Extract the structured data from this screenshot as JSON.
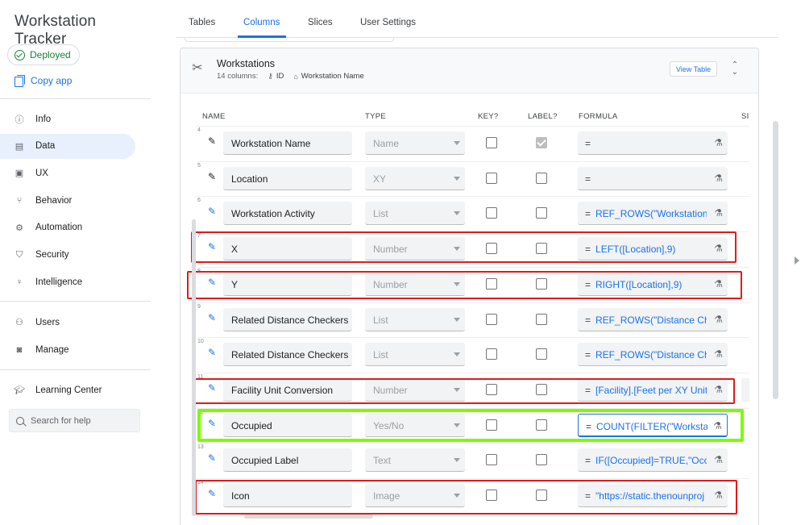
{
  "sidebar": {
    "app_title": "Workstation Tracker",
    "status_label": "Deployed",
    "copy_app_label": "Copy app",
    "nav_group_1": [
      {
        "label": "Info",
        "icon": "info-icon"
      },
      {
        "label": "Data",
        "icon": "data-icon",
        "active": true
      },
      {
        "label": "UX",
        "icon": "ux-icon"
      },
      {
        "label": "Behavior",
        "icon": "behavior-icon"
      },
      {
        "label": "Automation",
        "icon": "automation-icon"
      },
      {
        "label": "Security",
        "icon": "shield-icon"
      },
      {
        "label": "Intelligence",
        "icon": "lightbulb-icon"
      }
    ],
    "nav_group_2": [
      {
        "label": "Users",
        "icon": "users-icon"
      },
      {
        "label": "Manage",
        "icon": "manage-icon"
      }
    ],
    "learning_center_label": "Learning Center",
    "search_placeholder": "Search for help"
  },
  "tabs": [
    {
      "label": "Tables"
    },
    {
      "label": "Columns",
      "active": true
    },
    {
      "label": "Slices"
    },
    {
      "label": "User Settings"
    }
  ],
  "table": {
    "title": "Workstations",
    "column_count": "14 columns:",
    "key_meta": "ID",
    "label_meta": "Workstation Name",
    "view_table_label": "View Table"
  },
  "column_headers": {
    "name": "NAME",
    "type": "TYPE",
    "key": "KEY?",
    "label": "LABEL?",
    "formula": "FORMULA",
    "show": "SI"
  },
  "rows": [
    {
      "num": "4",
      "name": "Workstation Name",
      "type": "Name",
      "key": false,
      "label": true,
      "formula": "",
      "pencil": "dark"
    },
    {
      "num": "5",
      "name": "Location",
      "type": "XY",
      "key": false,
      "label": false,
      "formula": "",
      "pencil": "dark"
    },
    {
      "num": "6",
      "name": "Workstation Activity",
      "type": "List",
      "key": false,
      "label": false,
      "formula": "REF_ROWS(\"Workstation",
      "pencil": "blue"
    },
    {
      "num": "7",
      "name": "X",
      "type": "Number",
      "key": false,
      "label": false,
      "formula": "LEFT([Location],9)",
      "pencil": "blue"
    },
    {
      "num": "8",
      "name": "Y",
      "type": "Number",
      "key": false,
      "label": false,
      "formula": "RIGHT([Location],9)",
      "pencil": "blue"
    },
    {
      "num": "9",
      "name": "Related Distance Checkers",
      "type": "List",
      "key": false,
      "label": false,
      "formula": "REF_ROWS(\"Distance Che",
      "pencil": "blue"
    },
    {
      "num": "10",
      "name": "Related Distance Checkers",
      "type": "List",
      "key": false,
      "label": false,
      "formula": "REF_ROWS(\"Distance Che",
      "pencil": "blue"
    },
    {
      "num": "11",
      "name": "Facility Unit Conversion",
      "type": "Number",
      "key": false,
      "label": false,
      "formula": "[Facility].[Feet per XY Unit",
      "pencil": "blue"
    },
    {
      "num": "12",
      "name": "Occupied",
      "type": "Yes/No",
      "key": false,
      "label": false,
      "formula": "COUNT(FILTER(\"Workstat",
      "pencil": "blue",
      "focused": true
    },
    {
      "num": "13",
      "name": "Occupied Label",
      "type": "Text",
      "key": false,
      "label": false,
      "formula": "IF([Occupied]=TRUE,\"Occu",
      "pencil": "blue"
    },
    {
      "num": "14",
      "name": "Icon",
      "type": "Image",
      "key": false,
      "label": false,
      "formula": "\"https://static.thenounproj",
      "pencil": "blue"
    }
  ],
  "colors": {
    "accent": "#1a73e8",
    "highlight_red": "#e01b1b",
    "highlight_green": "#7cfc00",
    "deployed_green": "#188038"
  }
}
